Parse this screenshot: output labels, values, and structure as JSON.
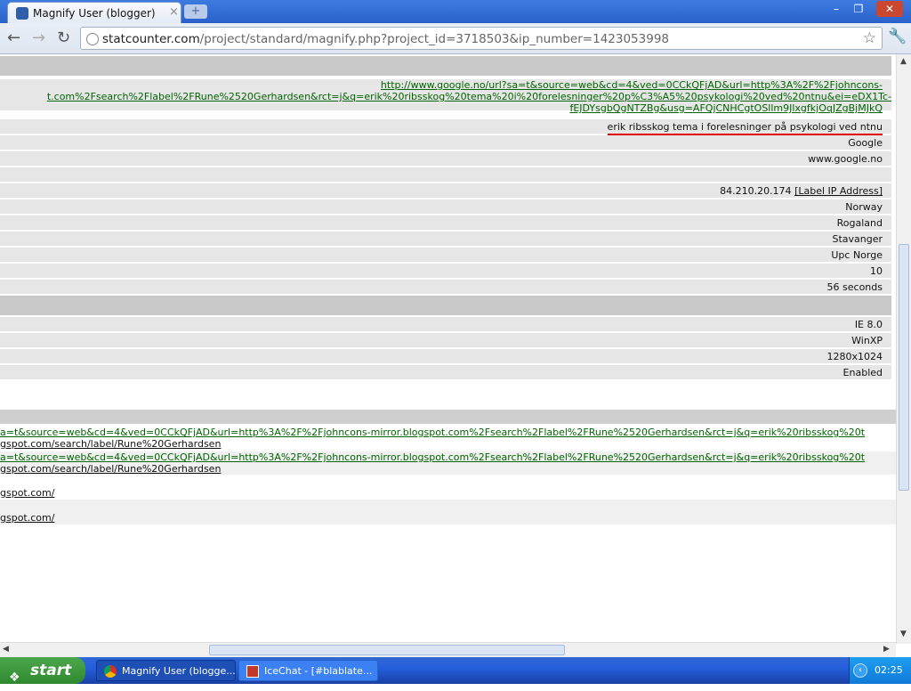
{
  "browser": {
    "tab_title": "Magnify User (blogger)",
    "tab_close": "×",
    "new_tab": "+",
    "url_host": "statcounter.com",
    "url_path": "/project/standard/magnify.php?project_id=3718503&ip_number=1423053998",
    "min_label": "–",
    "max_label": "❐",
    "close_label": "✕"
  },
  "referrer": {
    "line1": "http://www.google.no/url?sa=t&source=web&cd=4&ved=0CCkQFjAD&url=http%3A%2F%2Fjohncons-",
    "line2": "t.com%2Fsearch%2Flabel%2FRune%2520Gerhardsen&rct=j&q=erik%20ribsskog%20tema%20i%20forelesninger%20p%C3%A5%20psykologi%20ved%20ntnu&ei=eDX1Tc-",
    "line3": "fEJDYsgbQgNTZBg&usg=AFQjCNHCgtOSllm9JlxgfkjOqJZgBjMJkQ"
  },
  "details": {
    "search_query": "erik ribsskog tema i forelesninger på psykologi ved ntnu",
    "search_engine": "Google",
    "engine_host": "www.google.no",
    "ip": "84.210.20.174",
    "label_ip": "[Label IP Address]",
    "country": "Norway",
    "region": "Rogaland",
    "city": "Stavanger",
    "isp": "Upc Norge",
    "returning_visits": "10",
    "visit_length": "56 seconds",
    "browser": "IE 8.0",
    "os": "WinXP",
    "resolution": "1280x1024",
    "javascript": "Enabled"
  },
  "visits": {
    "ref1_a": "a=t&source=web&cd=4&ved=0CCkQFjAD&url=http%3A%2F%2Fjohncons-mirror.blogspot.com%2Fsearch%2Flabel%2FRune%2520Gerhardsen&rct=j&q=erik%20ribsskog%20t",
    "ref1_b": "gspot.com/search/label/Rune%20Gerhardsen",
    "ref2_a": "a=t&source=web&cd=4&ved=0CCkQFjAD&url=http%3A%2F%2Fjohncons-mirror.blogspot.com%2Fsearch%2Flabel%2FRune%2520Gerhardsen&rct=j&q=erik%20ribsskog%20t",
    "ref2_b": "gspot.com/search/label/Rune%20Gerhardsen",
    "page1": "gspot.com/",
    "page2": "gspot.com/"
  },
  "taskbar": {
    "start": "start",
    "task1": "Magnify User (blogge...",
    "task2": "IceChat - [#blablate...",
    "clock": "02:25"
  },
  "colors": {
    "link_green": "#006400",
    "row_grey": "#e6e6e6",
    "header_grey": "#c8c8c8",
    "underline_red": "#e00000"
  }
}
